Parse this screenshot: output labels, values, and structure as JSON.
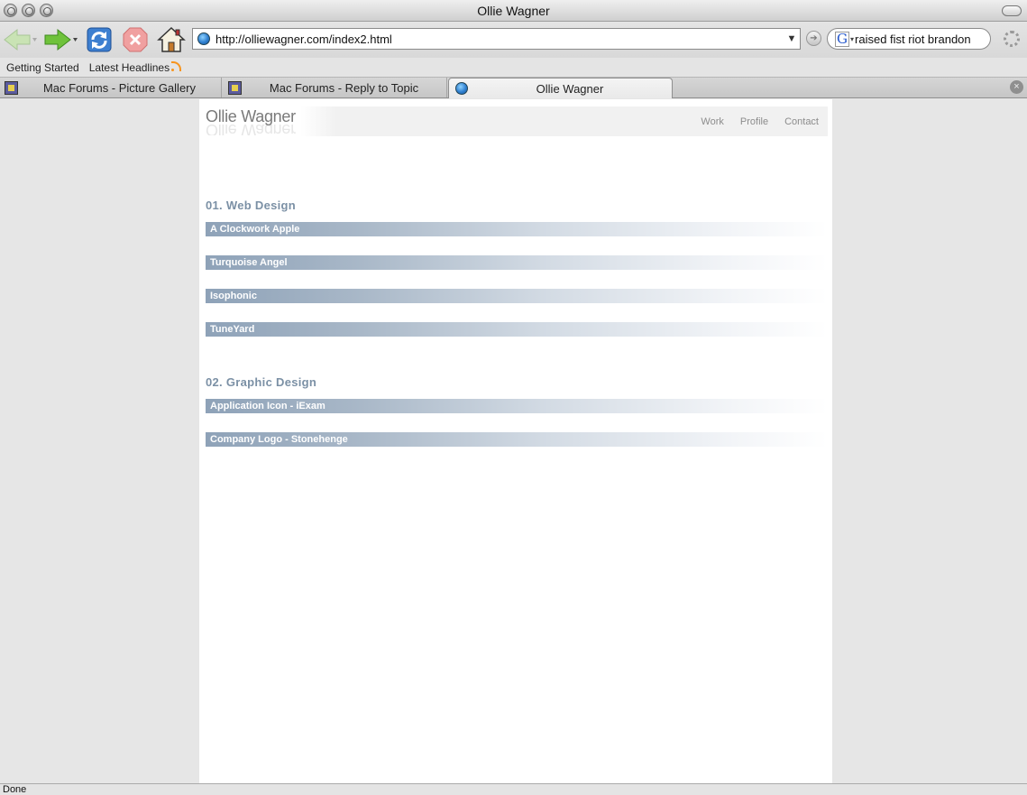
{
  "window": {
    "title": "Ollie Wagner"
  },
  "toolbar": {
    "url": "http://olliewagner.com/index2.html",
    "search_value": "raised fist riot brandon",
    "search_engine_icon": "G"
  },
  "bookmarks": [
    "Getting Started",
    "Latest Headlines"
  ],
  "tabs": [
    {
      "label": "Mac Forums - Picture Gallery"
    },
    {
      "label": "Mac Forums - Reply to Topic"
    },
    {
      "label": "Ollie Wagner"
    }
  ],
  "site": {
    "logo": "Ollie Wagner",
    "nav": [
      "Work",
      "Profile",
      "Contact"
    ],
    "sections": [
      {
        "title": "01. Web Design",
        "items": [
          "A Clockwork Apple",
          "Turquoise Angel",
          "Isophonic",
          "TuneYard"
        ]
      },
      {
        "title": "02. Graphic Design",
        "items": [
          "Application Icon - iExam",
          "Company Logo - Stonehenge"
        ]
      }
    ]
  },
  "status": {
    "text": "Done"
  },
  "colors": {
    "section_title": "#7b90a5",
    "bar_start": "#8ea2b8",
    "page_bg": "#e6e6e6"
  }
}
